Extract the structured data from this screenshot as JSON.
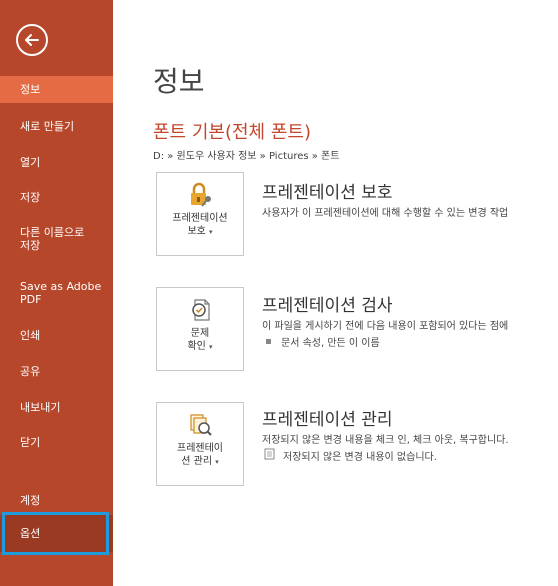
{
  "sidebar": {
    "items": [
      {
        "label": "정보"
      },
      {
        "label": "새로 만들기"
      },
      {
        "label": "열기"
      },
      {
        "label": "저장"
      },
      {
        "label": "다른 이름으로\n저장"
      },
      {
        "label": "Save as Adobe\nPDF"
      },
      {
        "label": "인쇄"
      },
      {
        "label": "공유"
      },
      {
        "label": "내보내기"
      },
      {
        "label": "닫기"
      },
      {
        "label": "계정"
      },
      {
        "label": "옵션"
      }
    ],
    "selected": "정보",
    "highlighted": "옵션"
  },
  "main": {
    "page_title": "정보",
    "doc_title": "폰트 기본(전체 폰트)",
    "breadcrumb": "D: » 윈도우 사용자 정보 » Pictures » 폰트",
    "sections": [
      {
        "button_label_1": "프레젠테이션",
        "button_label_2": "보호",
        "title": "프레젠테이션 보호",
        "description": "사용자가 이 프레젠테이션에 대해 수행할 수 있는 변경 작업"
      },
      {
        "button_label_1": "문제",
        "button_label_2": "확인",
        "title": "프레젠테이션 검사",
        "description": "이 파일을 게시하기 전에 다음 내용이 포함되어 있다는 점에",
        "sub": "문서 속성, 만든 이 이름"
      },
      {
        "button_label_1": "프레젠테이",
        "button_label_2": "션 관리",
        "title": "프레젠테이션 관리",
        "description": "저장되지 않은 변경 내용을 체크 인, 체크 아웃, 복구합니다.",
        "sub": "저장되지 않은 변경 내용이 없습니다."
      }
    ]
  },
  "colors": {
    "sidebar_bg": "#b7472a",
    "sidebar_selected": "#e56b44",
    "accent_text": "#c4462b",
    "highlight_border": "#1e9bdd"
  }
}
